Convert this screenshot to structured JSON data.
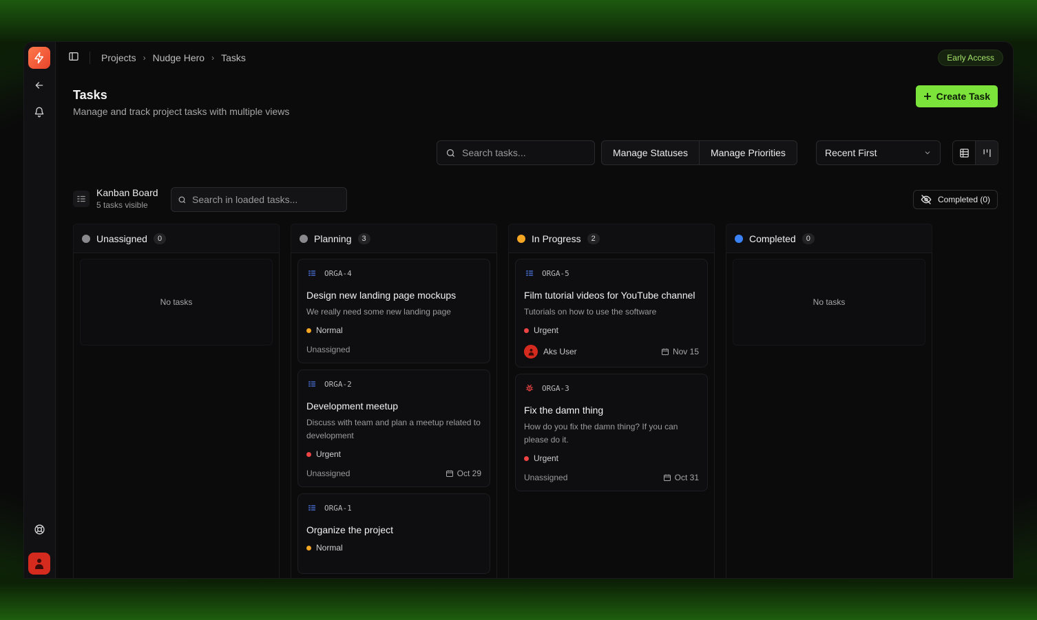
{
  "breadcrumb": [
    "Projects",
    "Nudge Hero",
    "Tasks"
  ],
  "badge": "Early Access",
  "page": {
    "title": "Tasks",
    "subtitle": "Manage and track project tasks with multiple views",
    "create_label": "Create Task"
  },
  "toolbar": {
    "search_placeholder": "Search tasks...",
    "manage_statuses": "Manage Statuses",
    "manage_priorities": "Manage Priorities",
    "sort_value": "Recent First"
  },
  "board": {
    "title": "Kanban Board",
    "subtitle": "5 tasks visible",
    "search_placeholder": "Search in loaded tasks...",
    "completed_toggle": "Completed (0)"
  },
  "colors": {
    "accent": "#7be33a",
    "unassigned": "#8a8a8e",
    "planning": "#8a8a8e",
    "in_progress": "#f5a623",
    "completed": "#3b82f6",
    "normal": "#f5a623",
    "urgent": "#ef4444"
  },
  "columns": [
    {
      "name": "Unassigned",
      "count": "0",
      "empty_text": "No tasks"
    },
    {
      "name": "Planning",
      "count": "3"
    },
    {
      "name": "In Progress",
      "count": "2"
    },
    {
      "name": "Completed",
      "count": "0",
      "empty_text": "No tasks"
    }
  ],
  "cards": {
    "orga4": {
      "id": "ORGA-4",
      "title": "Design new landing page mockups",
      "desc": "We really need some new landing page",
      "priority": "Normal",
      "assignee": "Unassigned"
    },
    "orga2": {
      "id": "ORGA-2",
      "title": "Development meetup",
      "desc": "Discuss with team and plan a meetup related to development",
      "priority": "Urgent",
      "assignee": "Unassigned",
      "due": "Oct 29"
    },
    "orga1": {
      "id": "ORGA-1",
      "title": "Organize the project",
      "priority": "Normal"
    },
    "orga5": {
      "id": "ORGA-5",
      "title": "Film tutorial videos for YouTube channel",
      "desc": "Tutorials on how to use the software",
      "priority": "Urgent",
      "assignee": "Aks User",
      "due": "Nov 15"
    },
    "orga3": {
      "id": "ORGA-3",
      "title": "Fix the damn thing",
      "desc": "How do you fix the damn thing? If you can please do it.",
      "priority": "Urgent",
      "assignee": "Unassigned",
      "due": "Oct 31"
    }
  }
}
